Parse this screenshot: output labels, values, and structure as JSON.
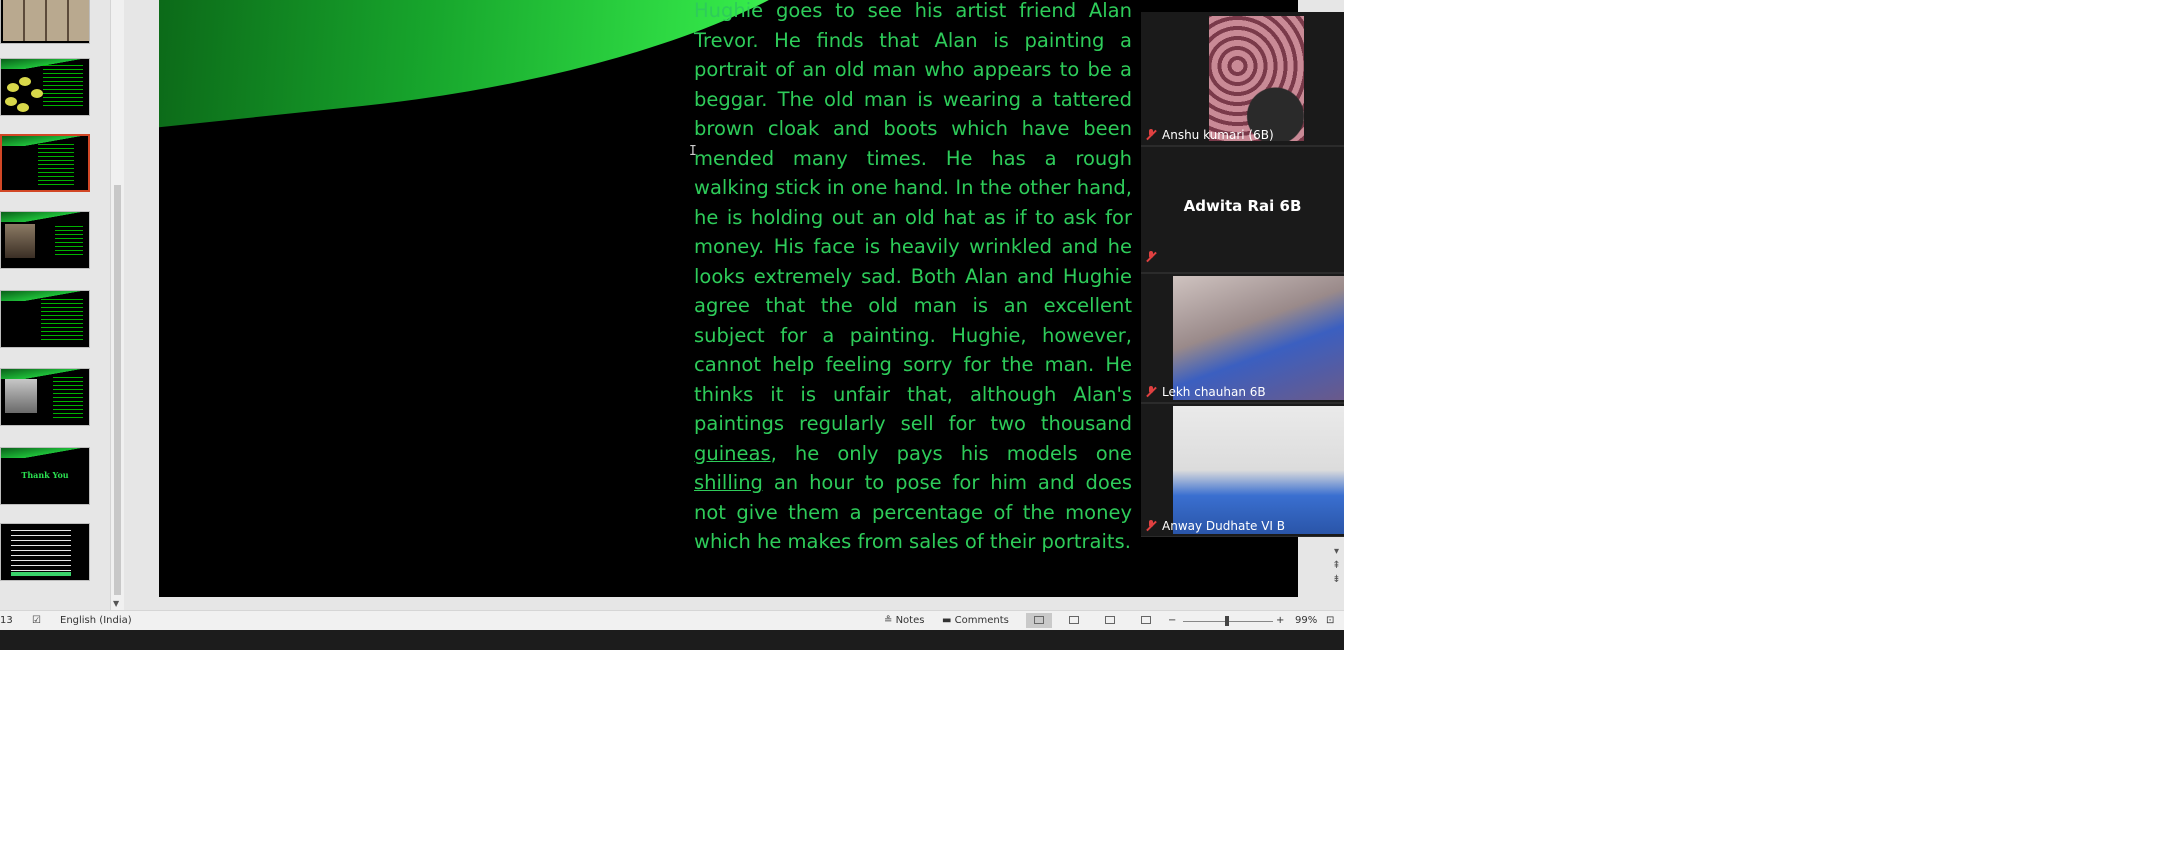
{
  "slide": {
    "body_parts": [
      "Hughie goes to see his artist friend Alan Trevor. He finds that Alan is painting a portrait of an old man who appears to be a beggar. The old man is wearing a tattered brown cloak and boots which have been mended many times. He has a rough walking stick in one hand. In the other hand, he is holding out an old hat as if to ask for money. His face is heavily wrinkled and he looks extremely sad. Both Alan and Hughie agree that the old man is an excellent subject for a painting. Hughie, however, cannot help feeling sorry for the man. He thinks it is unfair that, although Alan's paintings regularly sell for two thousand ",
      "guineas",
      ", he only pays his models one ",
      "shilling",
      " an hour to pose for him and does not give them a percentage of the money which he makes from sales of their portraits."
    ],
    "text_color": "#2ecc5a",
    "cursor_glyph": "I"
  },
  "thumbnails": {
    "thank_you_text": "Thank You"
  },
  "participants": [
    {
      "name": "Anshu kumari (6B)",
      "muted": true
    },
    {
      "name": "",
      "display_name": "Adwita Rai 6B",
      "muted": true
    },
    {
      "name": "Lekh chauhan 6B",
      "muted": true
    },
    {
      "name": "Anway  Dudhate VI B",
      "muted": true
    }
  ],
  "status_bar": {
    "slide_counter": "13",
    "language": "English (India)",
    "notes_label": "Notes",
    "comments_label": "Comments",
    "zoom_minus": "−",
    "zoom_plus": "+",
    "zoom_level": "99%"
  },
  "colors": {
    "selected_thumb_border": "#d24726",
    "mute_icon": "#e04040"
  }
}
